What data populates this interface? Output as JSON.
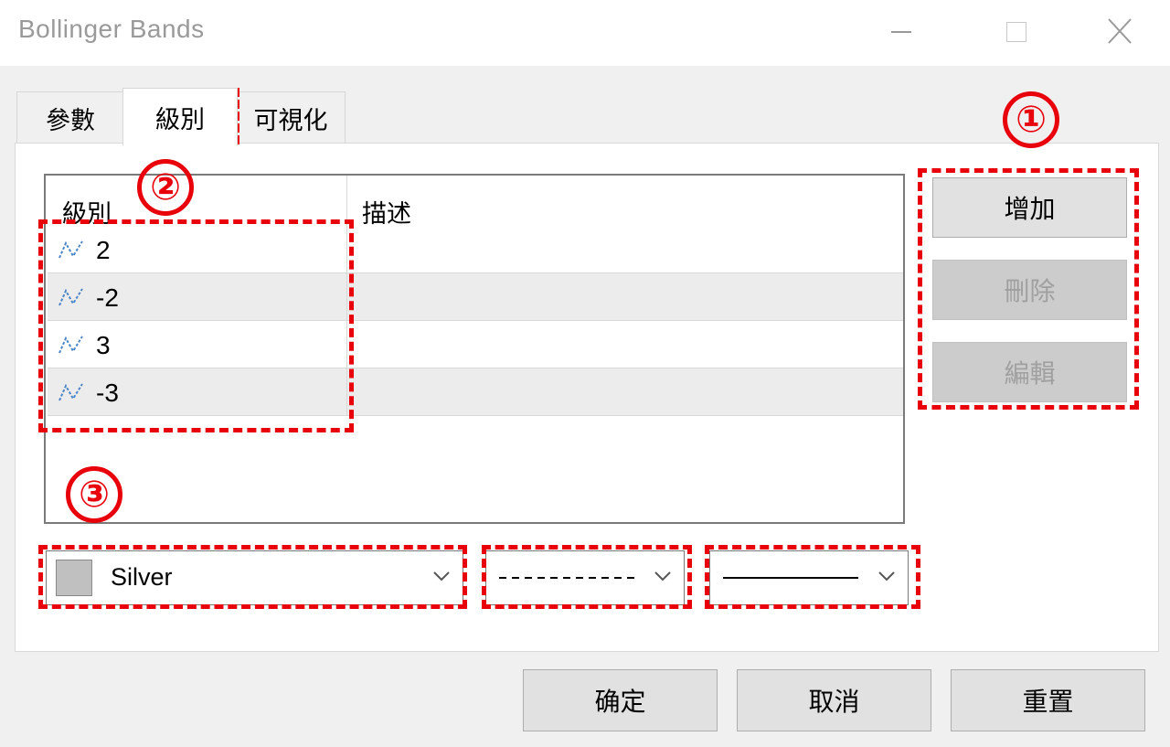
{
  "window": {
    "title": "Bollinger Bands",
    "controls": [
      "minimize-icon",
      "maximize-icon",
      "close-icon"
    ]
  },
  "tabs": [
    {
      "label": "參數",
      "active": false
    },
    {
      "label": "級別",
      "active": true
    },
    {
      "label": "可視化",
      "active": false
    }
  ],
  "levels_table": {
    "columns": [
      "級別",
      "描述"
    ],
    "rows": [
      {
        "level": "2",
        "description": ""
      },
      {
        "level": "-2",
        "description": ""
      },
      {
        "level": "3",
        "description": ""
      },
      {
        "level": "-3",
        "description": ""
      }
    ],
    "row_icon": "level-line-icon"
  },
  "side_buttons": [
    {
      "label": "增加",
      "enabled": true
    },
    {
      "label": "刪除",
      "enabled": false
    },
    {
      "label": "編輯",
      "enabled": false
    }
  ],
  "style_controls": {
    "color": {
      "label": "Silver",
      "hex": "#c0c0c0"
    },
    "line_style": "dashed",
    "line_width": "solid-thin"
  },
  "footer_buttons": [
    "确定",
    "取消",
    "重置"
  ],
  "annotations": {
    "color": "#e8000b",
    "badges": [
      "①",
      "②",
      "③"
    ]
  }
}
